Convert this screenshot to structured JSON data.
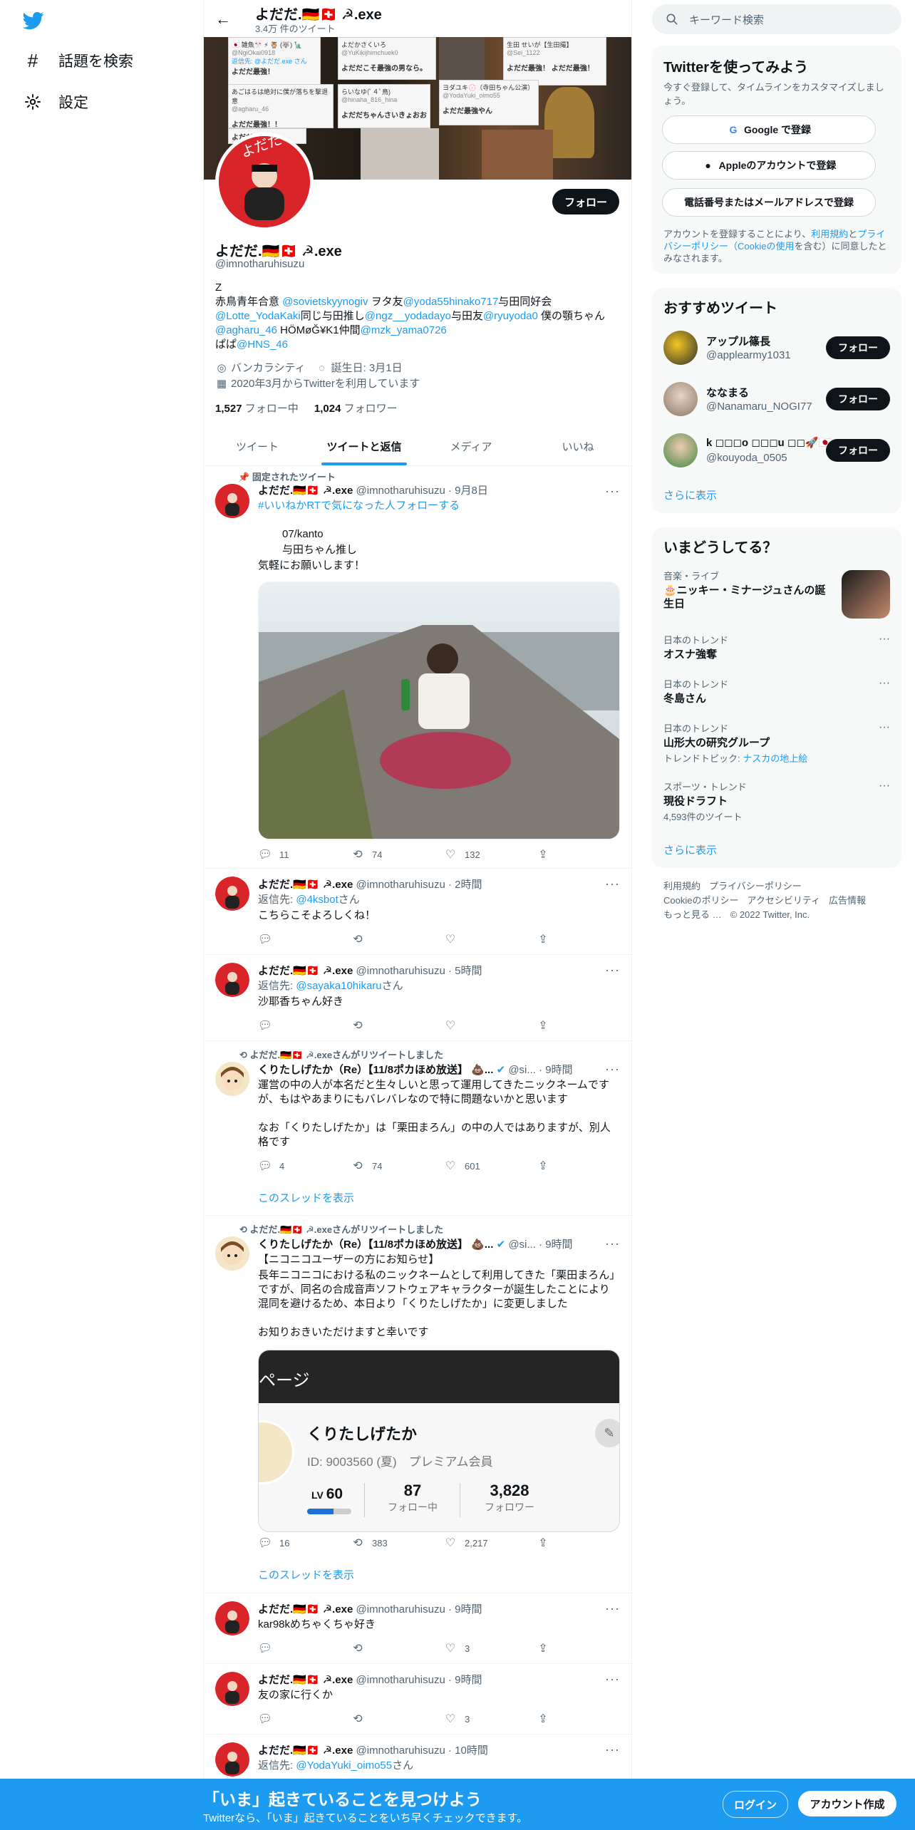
{
  "nav": {
    "explore": "話題を検索",
    "settings": "設定"
  },
  "profile": {
    "name": "よだだ.🇩🇪🇨🇭 ☭.exe",
    "tweet_count": "3.4万 件のツイート",
    "handle": "@imnotharuhisuzu",
    "follow": "フォロー",
    "bio": [
      "Z",
      "赤鳥青年合意 @sovietskyynogiv ヲタ友@yoda55hinako717与田同好会",
      "@Lotte_YodaKaki同じ与田推し@ngz__yodadayo与田友@ryuyoda0 僕の顎ちゃん",
      "@agharu_46 HÖMøĞ¥K1仲間@mzk_yama0726",
      "ぱぱ@HNS_46"
    ],
    "location": "バンカラシティ",
    "birthday": "誕生日: 3月1日",
    "joined": "2020年3月からTwitterを利用しています",
    "following_count": "1,527",
    "following_label": "フォロー中",
    "followers_count": "1,024",
    "followers_label": "フォロワー"
  },
  "banner_text": {
    "c1_name": "🇯🇵 雑魚🎌 ⚡ 🦉 (🐺) 🗽",
    "c1_handle": "@NgiOkai0918",
    "c1_reply": "返信先: @よだだ.exe さん",
    "c1_msg": "よだだ最強！",
    "c2_name": "よだかさくいろ",
    "c2_handle": "@YuKikijhimchuek0",
    "c2_msg": "よだだこそ最強の男なら。",
    "c3_name": "生田 せいが【生田撮】",
    "c3_handle": "@Sei_1122",
    "c3_msg": "よだだ最強！ よだだ最強！",
    "c4_name": "あごはるは絶対に僕が落ちを撃退意",
    "c4_handle": "@agharu_46",
    "c4_msg": "よだだ最強！！",
    "c5_name": "らいなゆ(ﾟ４ﾟ鳥)",
    "c5_handle": "@hinaha_816_hina",
    "c5_msg": "よだだちゃんさいきょおお",
    "c6_name": "ヨダユキ💮（寺田ちゃん公演）",
    "c6_handle": "@YodaYuki_oimo55",
    "c6_msg": "よだだ最強やん",
    "c7_msg": "よだだだよ"
  },
  "tabs": [
    "ツイート",
    "ツイートと返信",
    "メディア",
    "いいね"
  ],
  "tweets": {
    "pinned_label": "固定されたツイート",
    "t1": {
      "name": "よだだ.🇩🇪🇨🇭 ☭.exe",
      "handle": "@imnotharuhisuzu",
      "time": "9月8日",
      "hashtag": "#いいねかRTで気になった人フォローする",
      "l1": "07/kanto",
      "l2": "与田ちゃん推し",
      "l3": "気軽にお願いします！",
      "replies": "11",
      "retweets": "74",
      "likes": "132"
    },
    "t2": {
      "name": "よだだ.🇩🇪🇨🇭 ☭.exe",
      "handle": "@imnotharuhisuzu",
      "time": "2時間",
      "reply_prefix": "返信先: ",
      "reply_to": "@4ksbot",
      "reply_suffix": "さん",
      "text": "こちらこそよろしくね！"
    },
    "t3": {
      "name": "よだだ.🇩🇪🇨🇭 ☭.exe",
      "handle": "@imnotharuhisuzu",
      "time": "5時間",
      "reply_prefix": "返信先: ",
      "reply_to": "@sayaka10hikaru",
      "reply_suffix": "さん",
      "text": "沙耶香ちゃん好き"
    },
    "t4": {
      "context": "よだだ.🇩🇪🇨🇭 ☭.exeさんがリツイートしました",
      "name": "くりたしげたか（Re）【11/8ポカほめ放送】 💩...",
      "handle": "@si...",
      "time": "9時間",
      "text1": "運営の中の人が本名だと生々しいと思って運用してきたニックネームですが、もはやあまりにもバレバレなので特に問題ないかと思います",
      "text2": "なお「くりたしげたか」は「栗田まろん」の中の人ではありますが、別人格です",
      "replies": "4",
      "retweets": "74",
      "likes": "601",
      "thread": "このスレッドを表示"
    },
    "t5": {
      "context": "よだだ.🇩🇪🇨🇭 ☭.exeさんがリツイートしました",
      "name": "くりたしげたか（Re）【11/8ポカほめ放送】 💩...",
      "handle": "@si...",
      "time": "9時間",
      "text1": "【ニコニコユーザーの方にお知らせ】",
      "text2": "長年ニコニコにおける私のニックネームとして利用してきた「栗田まろん」ですが、同名の合成音声ソフトウェアキャラクターが誕生したことにより混同を避けるため、本日より「くりたしげたか」に変更しました",
      "text3": "お知りおきいただけますと幸いです",
      "card_header": "ページ",
      "card_name": "くりたしげたか",
      "card_id": "ID: 9003560 (夏)　プレミアム会員",
      "card_lv_label": "LV",
      "card_lv": "60",
      "card_following": "87",
      "card_following_label": "フォロー中",
      "card_followers": "3,828",
      "card_followers_label": "フォロワー",
      "card_progress": 0.6,
      "replies": "16",
      "retweets": "383",
      "likes": "2,217",
      "thread": "このスレッドを表示"
    },
    "t6": {
      "name": "よだだ.🇩🇪🇨🇭 ☭.exe",
      "handle": "@imnotharuhisuzu",
      "time": "9時間",
      "text": "kar98kめちゃくちゃ好き",
      "likes": "3"
    },
    "t7": {
      "name": "よだだ.🇩🇪🇨🇭 ☭.exe",
      "handle": "@imnotharuhisuzu",
      "time": "9時間",
      "text": "友の家に行くか",
      "likes": "3"
    },
    "t8": {
      "name": "よだだ.🇩🇪🇨🇭 ☭.exe",
      "handle": "@imnotharuhisuzu",
      "time": "10時間",
      "reply_prefix": "返信先: ",
      "reply_to": "@YodaYuki_oimo55",
      "reply_suffix": "さん"
    }
  },
  "right": {
    "search_placeholder": "キーワード検索",
    "signup_title": "Twitterを使ってみよう",
    "signup_sub": "今すぐ登録して、タイムラインをカスタマイズしましょう。",
    "google": "Google で登録",
    "apple": "Appleのアカウントで登録",
    "phone": "電話番号またはメールアドレスで登録",
    "terms_1": "アカウントを登録することにより、",
    "terms_link1": "利用規約",
    "terms_2": "と",
    "terms_link2": "プライバシーポリシー（Cookieの使用",
    "terms_3": "を含む）に同意したとみなされます。",
    "rec_title": "おすすめツイート",
    "recs": [
      {
        "name": "アップル篠長",
        "handle": "@applearmy1031",
        "follow": "フォロー"
      },
      {
        "name": "ななまる",
        "handle": "@Nanamaru_NOGI77",
        "follow": "フォロー"
      },
      {
        "name": "k ◻◻◻o ◻◻◻u ◻◻🚀🇯🇵",
        "handle": "@kouyoda_0505",
        "follow": "フォロー"
      }
    ],
    "show_more": "さらに表示",
    "trend_title": "いまどうしてる？",
    "trends": [
      {
        "cat": "音楽・ライブ",
        "title": "🎂ニッキー・ミナージュさんの誕生日",
        "sub": ""
      },
      {
        "cat": "日本のトレンド",
        "title": "オスナ強奪",
        "sub": ""
      },
      {
        "cat": "日本のトレンド",
        "title": "冬島さん",
        "sub": ""
      },
      {
        "cat": "日本のトレンド",
        "title": "山形大の研究グループ",
        "sub": "トレンドトピック: ",
        "sub_link": "ナスカの地上絵"
      },
      {
        "cat": "スポーツ・トレンド",
        "title": "現役ドラフト",
        "sub": "4,593件のツイート"
      }
    ],
    "footer": [
      "利用規約",
      "プライバシーポリシー",
      "Cookieのポリシー",
      "アクセシビリティ",
      "広告情報",
      "もっと見る …",
      "© 2022 Twitter, Inc."
    ]
  },
  "bottom": {
    "title": "「いま」起きていることを見つけよう",
    "sub": "Twitterなら、「いま」起きていることをいち早くチェックできます。",
    "login": "ログイン",
    "signup": "アカウント作成"
  },
  "colors": {
    "accent": "#1d9bf0",
    "text": "#0f1419",
    "muted": "#536471",
    "avatar_red": "#d9242a"
  }
}
